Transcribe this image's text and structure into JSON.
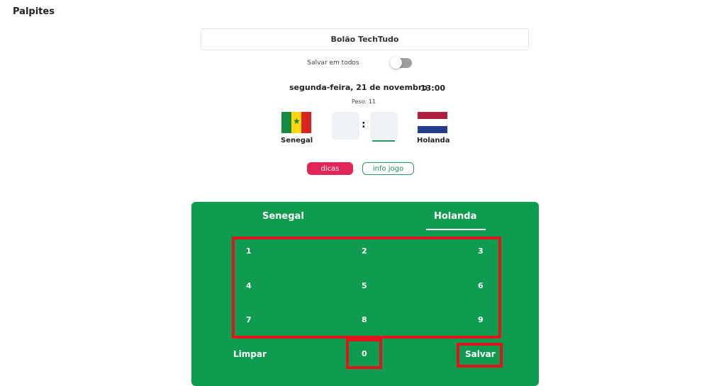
{
  "header": {
    "title": "Palpites"
  },
  "pool": {
    "name": "Bolão TechTudo"
  },
  "save_all": {
    "label": "Salvar em todos",
    "enabled": false
  },
  "match": {
    "date": "segunda-feira, 21 de novembro",
    "time": "13:00",
    "weight_label": "Peso:",
    "weight_value": "11",
    "home": {
      "name": "Senegal",
      "flag": "senegal-flag-icon"
    },
    "away": {
      "name": "Holanda",
      "flag": "netherlands-flag-icon"
    },
    "separator": ":"
  },
  "actions": {
    "tips": "dicas",
    "info": "info jogo"
  },
  "keypad": {
    "tabs": [
      {
        "label": "Senegal"
      },
      {
        "label": "Holanda"
      }
    ],
    "active_tab": "Holanda",
    "keys": [
      "1",
      "2",
      "3",
      "4",
      "5",
      "6",
      "7",
      "8",
      "9"
    ],
    "zero": "0",
    "clear": "Limpar",
    "save": "Salvar"
  },
  "colors": {
    "panel": "#0f9b50",
    "tips": "#e32558",
    "info_border": "#2a9a5c",
    "highlight": "#e0141a",
    "toggle_off": "#9e9e9e"
  }
}
